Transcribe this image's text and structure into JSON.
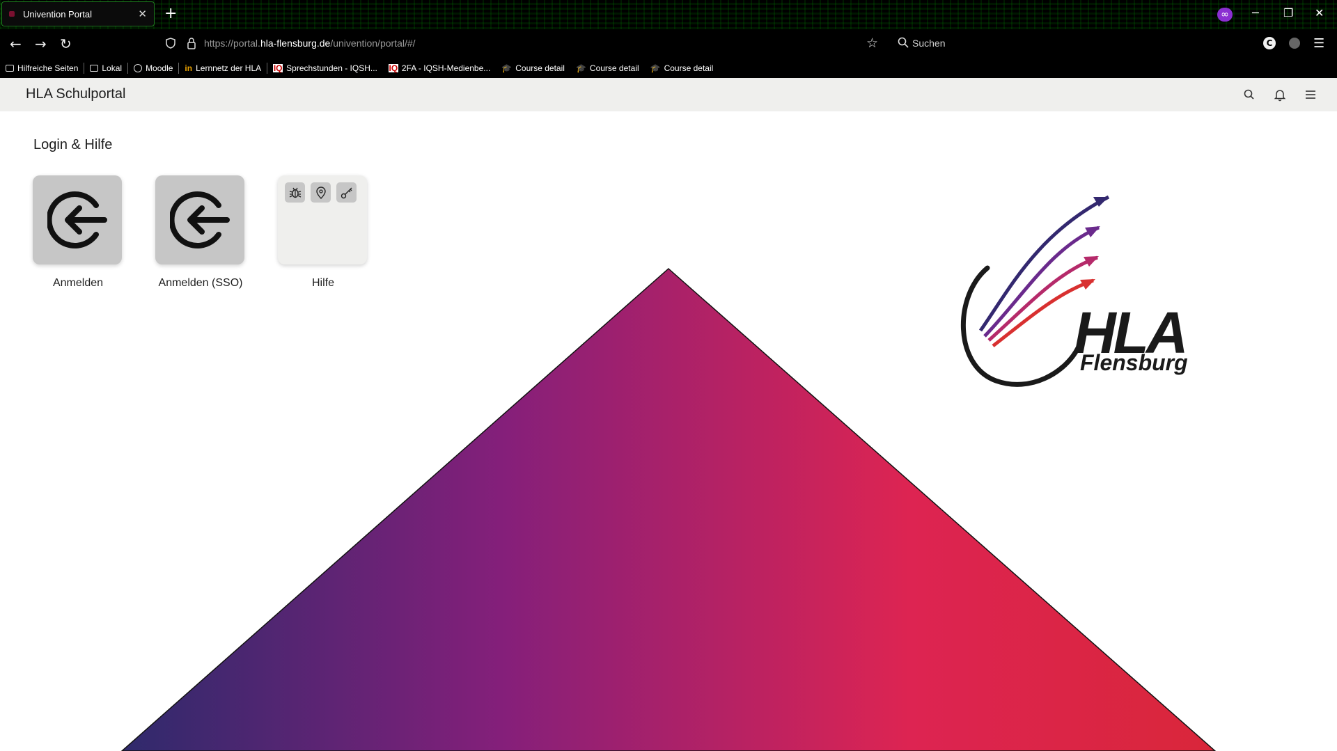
{
  "browser": {
    "tab_title": "Univention Portal",
    "tab_close": "✕",
    "new_tab": "+",
    "url_scheme": "https://portal.",
    "url_host": "hla-flensburg.de",
    "url_path": "/univention/portal/#/",
    "search_label": "Suchen",
    "extension_label": "C",
    "window_controls": {
      "minimize": "─",
      "restore": "❐",
      "close": "✕"
    },
    "bookmarks": [
      {
        "label": "Hilfreiche Seiten",
        "icon": "folder-icon"
      },
      {
        "label": "Lokal",
        "icon": "folder-icon"
      },
      {
        "label": "Moodle",
        "icon": "globe-icon"
      },
      {
        "label": "Lernnetz der HLA",
        "icon": "im-icon"
      },
      {
        "label": "Sprechstunden - IQSH...",
        "icon": "iqsh-icon"
      },
      {
        "label": "2FA - IQSH-Medienbe...",
        "icon": "iqsh-icon"
      },
      {
        "label": "Course detail",
        "icon": "graduation-cap-icon"
      },
      {
        "label": "Course detail",
        "icon": "graduation-cap-icon"
      },
      {
        "label": "Course detail",
        "icon": "graduation-cap-icon"
      }
    ]
  },
  "portal": {
    "title": "HLA Schulportal",
    "section_title": "Login & Hilfe",
    "tiles": [
      {
        "label": "Anmelden",
        "icon": "login-arrow-icon"
      },
      {
        "label": "Anmelden (SSO)",
        "icon": "login-arrow-icon"
      },
      {
        "label": "Hilfe",
        "icon": "folder-tile",
        "sub_icons": [
          "bug-icon",
          "location-pin-icon",
          "key-icon"
        ]
      }
    ]
  },
  "logo": {
    "main": "HLA",
    "sub": "Flensburg"
  },
  "colors": {
    "triangle_left": "#33286f",
    "triangle_mid": "#87207a",
    "triangle_right": "#dc2452",
    "header_bg": "#efefed"
  }
}
